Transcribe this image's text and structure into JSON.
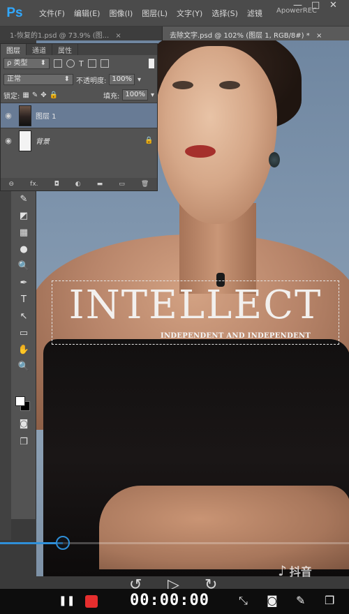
{
  "app": {
    "logo": "Ps",
    "menu": [
      "文件(F)",
      "编辑(E)",
      "图像(I)",
      "图层(L)",
      "文字(Y)",
      "选择(S)",
      "滤镜"
    ],
    "watermark": "ApowerREC"
  },
  "doc_tabs": [
    {
      "label": "1-恢复的1.psd @ 73.9% (图...",
      "close": "×"
    },
    {
      "label": "去除文字.psd @ 102% (图层 1, RGB/8#) *",
      "close": "×"
    }
  ],
  "layers_panel": {
    "tabs": [
      "图层",
      "通道",
      "属性"
    ],
    "filter_label": "ρ 类型",
    "blend_mode": "正常",
    "opacity_label": "不透明度:",
    "opacity_value": "100%",
    "lock_label": "锁定:",
    "fill_label": "填充:",
    "fill_value": "100%",
    "layers": [
      {
        "name": "图层 1",
        "selected": true,
        "thumb": "photo"
      },
      {
        "name": "背景",
        "selected": false,
        "thumb": "white",
        "locked": true
      }
    ],
    "footer_icons": [
      "link-icon",
      "fx-icon",
      "mask-icon",
      "adjustment-icon",
      "folder-icon",
      "new-layer-icon",
      "trash-icon"
    ],
    "footer_labels": [
      "⊖",
      "fx.",
      "◘",
      "◐",
      "▬",
      "▭",
      "🗑"
    ]
  },
  "tools": [
    "✎",
    "◩",
    "▦",
    "●",
    "🔍",
    "✒",
    "T",
    "↖",
    "▭",
    "✋",
    "🔍"
  ],
  "canvas": {
    "headline": "INTELLECT",
    "subline": "INDEPENDENT AND INDEPENDENT"
  },
  "recorder": {
    "timer": "00:00:00",
    "brand": "抖音",
    "progress": 0.18,
    "prev_symbol": "↺",
    "play_symbol": "▷",
    "next_symbol": "↻",
    "pause_symbol": "❚❚",
    "icons": [
      "⤡",
      "◙",
      "✎",
      "❐"
    ]
  }
}
